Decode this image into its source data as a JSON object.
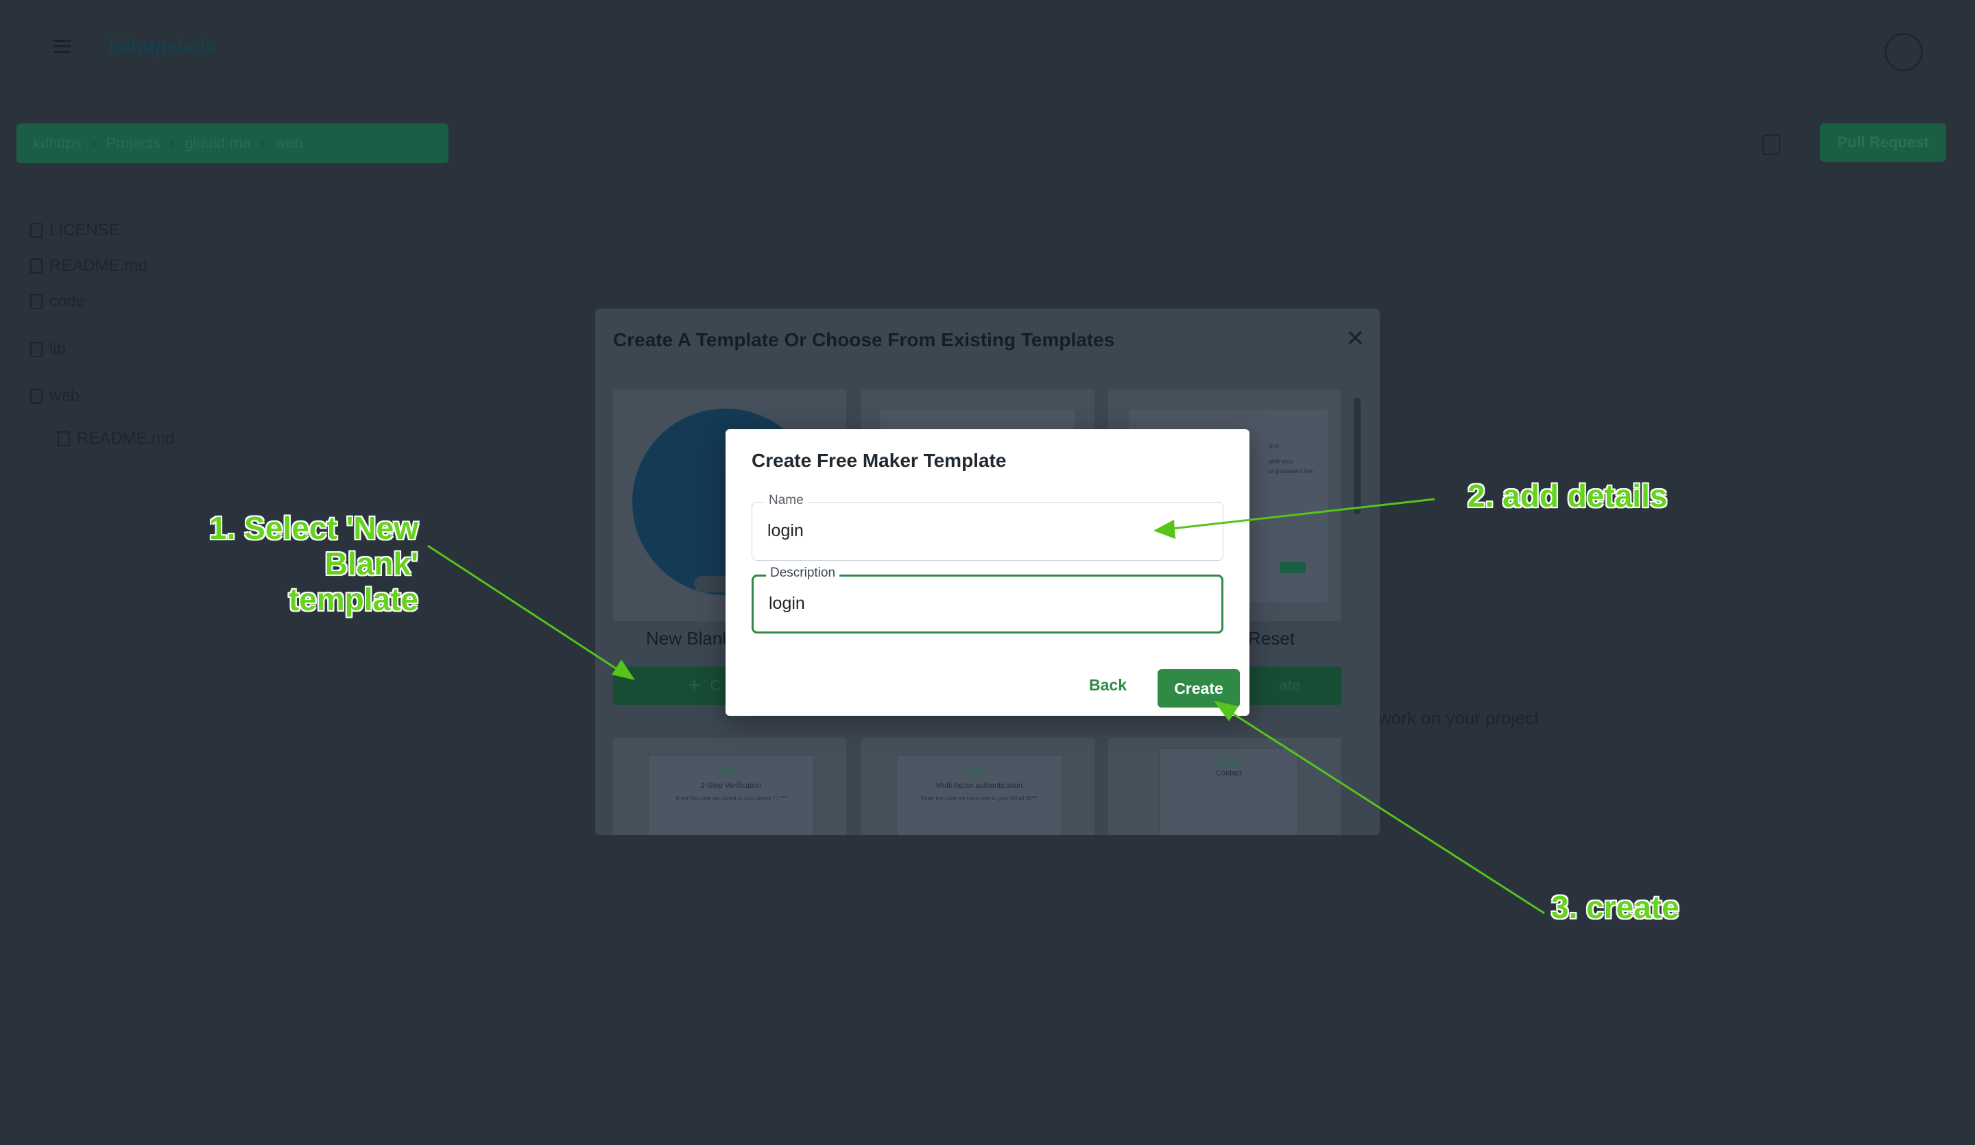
{
  "header": {
    "repo_title": "kdhttps/ads"
  },
  "breadcrumb": {
    "items": [
      "kdhttps",
      "Projects",
      "gluuid-ma",
      "web"
    ]
  },
  "toolbar": {
    "pull_request_label": "Pull Request"
  },
  "files": [
    "LICENSE",
    "README.md",
    "code",
    "lib",
    "web",
    "README.md"
  ],
  "background_hint": "work on your project",
  "outer_modal": {
    "title": "Create A Template Or Choose From Existing Templates",
    "cards": [
      {
        "label": "New Blank",
        "button_label": "C"
      },
      {
        "label": "",
        "button_label": ""
      },
      {
        "label": "Reset",
        "button_label": "ate"
      }
    ],
    "thumbnails": [
      {
        "brand": "gluu",
        "title": "2-Step Verification",
        "subtitle": "Enter the code we texted to your phone (*) ***"
      },
      {
        "brand": "gluu",
        "title": "Multi-factor authentication",
        "subtitle": "Enter the code we have sent to your Email ID***"
      },
      {
        "brand": "gluu",
        "title": "Contact",
        "subtitle": ""
      }
    ],
    "partial_texts": [
      "ord",
      "with your",
      "ur password link"
    ]
  },
  "dialog": {
    "title": "Create Free Maker Template",
    "name_label": "Name",
    "name_value": "login",
    "description_label": "Description",
    "description_value": "login",
    "back_label": "Back",
    "create_label": "Create"
  },
  "annotations": {
    "step1_line1": "1. Select 'New Blank'",
    "step1_line2": "template",
    "step2": "2. add details",
    "step3": "3. create",
    "arrow_color": "#56c41a"
  }
}
